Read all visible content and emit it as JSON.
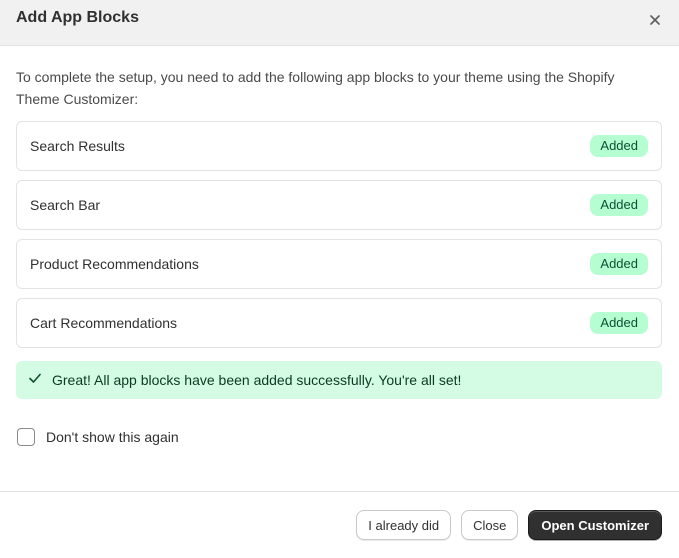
{
  "dialog": {
    "title": "Add App Blocks",
    "intro": "To complete the setup, you need to add the following app blocks to your theme using the Shopify Theme Customizer:"
  },
  "blocks": [
    {
      "label": "Search Results",
      "status": "Added"
    },
    {
      "label": "Search Bar",
      "status": "Added"
    },
    {
      "label": "Product Recommendations",
      "status": "Added"
    },
    {
      "label": "Cart Recommendations",
      "status": "Added"
    }
  ],
  "banner": {
    "message": "Great! All app blocks have been added successfully. You're all set!",
    "icon": "checkmark-icon"
  },
  "checkbox": {
    "label": "Don't show this again",
    "checked": false
  },
  "footer": {
    "already_did_label": "I already did",
    "close_label": "Close",
    "open_customizer_label": "Open Customizer"
  },
  "colors": {
    "badge_bg": "#b4fed2",
    "badge_text": "#0c5132",
    "banner_bg": "#d4fbe3",
    "primary_button": "#303030",
    "header_bg": "#f1f1f1"
  }
}
